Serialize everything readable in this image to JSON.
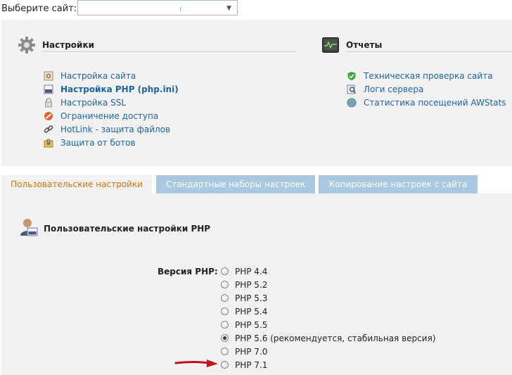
{
  "site_selector": {
    "label": "Выберите сайт:",
    "value": ""
  },
  "settings": {
    "title": "Настройки",
    "items": [
      {
        "label": "Настройка сайта",
        "icon": "gear-page-icon",
        "bold": false
      },
      {
        "label": "Настройка PHP (php.ini)",
        "icon": "php-file-icon",
        "bold": true
      },
      {
        "label": "Настройка SSL",
        "icon": "padlock-icon",
        "bold": false
      },
      {
        "label": "Ограничение доступа",
        "icon": "no-entry-icon",
        "bold": false
      },
      {
        "label": "HotLink - защита файлов",
        "icon": "chain-link-icon",
        "bold": false
      },
      {
        "label": "Защита от ботов",
        "icon": "lock-folder-icon",
        "bold": false
      }
    ]
  },
  "reports": {
    "title": "Отчеты",
    "items": [
      {
        "label": "Техническая проверка сайта",
        "icon": "shield-check-icon"
      },
      {
        "label": "Логи сервера",
        "icon": "log-search-icon"
      },
      {
        "label": "Статистика посещений AWStats",
        "icon": "globe-stats-icon"
      }
    ]
  },
  "tabs": [
    {
      "label": "Пользовательские настройки",
      "active": true
    },
    {
      "label": "Стандартные наборы настроек",
      "active": false
    },
    {
      "label": "Копирование настроек с сайта",
      "active": false
    }
  ],
  "php_settings": {
    "title": "Пользовательские настройки PHP",
    "version_label": "Версия PHP:",
    "versions": [
      {
        "label": "PHP 4.4",
        "checked": false
      },
      {
        "label": "PHP 5.2",
        "checked": false
      },
      {
        "label": "PHP 5.3",
        "checked": false
      },
      {
        "label": "PHP 5.4",
        "checked": false
      },
      {
        "label": "PHP 5.5",
        "checked": false
      },
      {
        "label": "PHP 5.6 (рекомендуется, стабильная версия)",
        "checked": true
      },
      {
        "label": "PHP 7.0",
        "checked": false
      },
      {
        "label": "PHP 7.1",
        "checked": false
      }
    ]
  },
  "colors": {
    "link": "#1d63a8",
    "active_tab": "#e07010",
    "inactive_tab": "#a9c8e2",
    "arrow": "#c0141a"
  }
}
